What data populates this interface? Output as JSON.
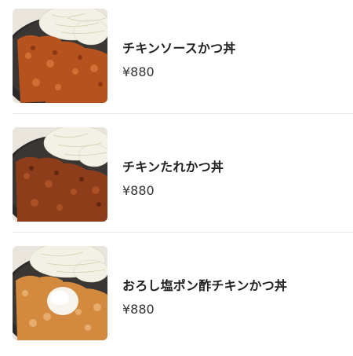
{
  "menu": {
    "items": [
      {
        "name": "チキンソースかつ丼",
        "price": "¥880",
        "image": "chicken-sauce-katsudon-photo"
      },
      {
        "name": "チキンたれかつ丼",
        "price": "¥880",
        "image": "chicken-tare-katsudon-photo"
      },
      {
        "name": "おろし塩ポン酢チキンかつ丼",
        "price": "¥880",
        "image": "oroshi-shio-ponzu-chicken-katsudon-photo"
      }
    ]
  },
  "colors": {
    "text_primary": "#202020",
    "text_price": "#333333",
    "divider": "#e8e8e8",
    "bowl": "#2a2a2a",
    "cabbage": "#f3f1e6",
    "katsu_sauce": "#b5521e",
    "katsu_tare": "#8e3d1a",
    "katsu_ponzu": "#d38a3f",
    "daikon": "#f7f4ee"
  }
}
